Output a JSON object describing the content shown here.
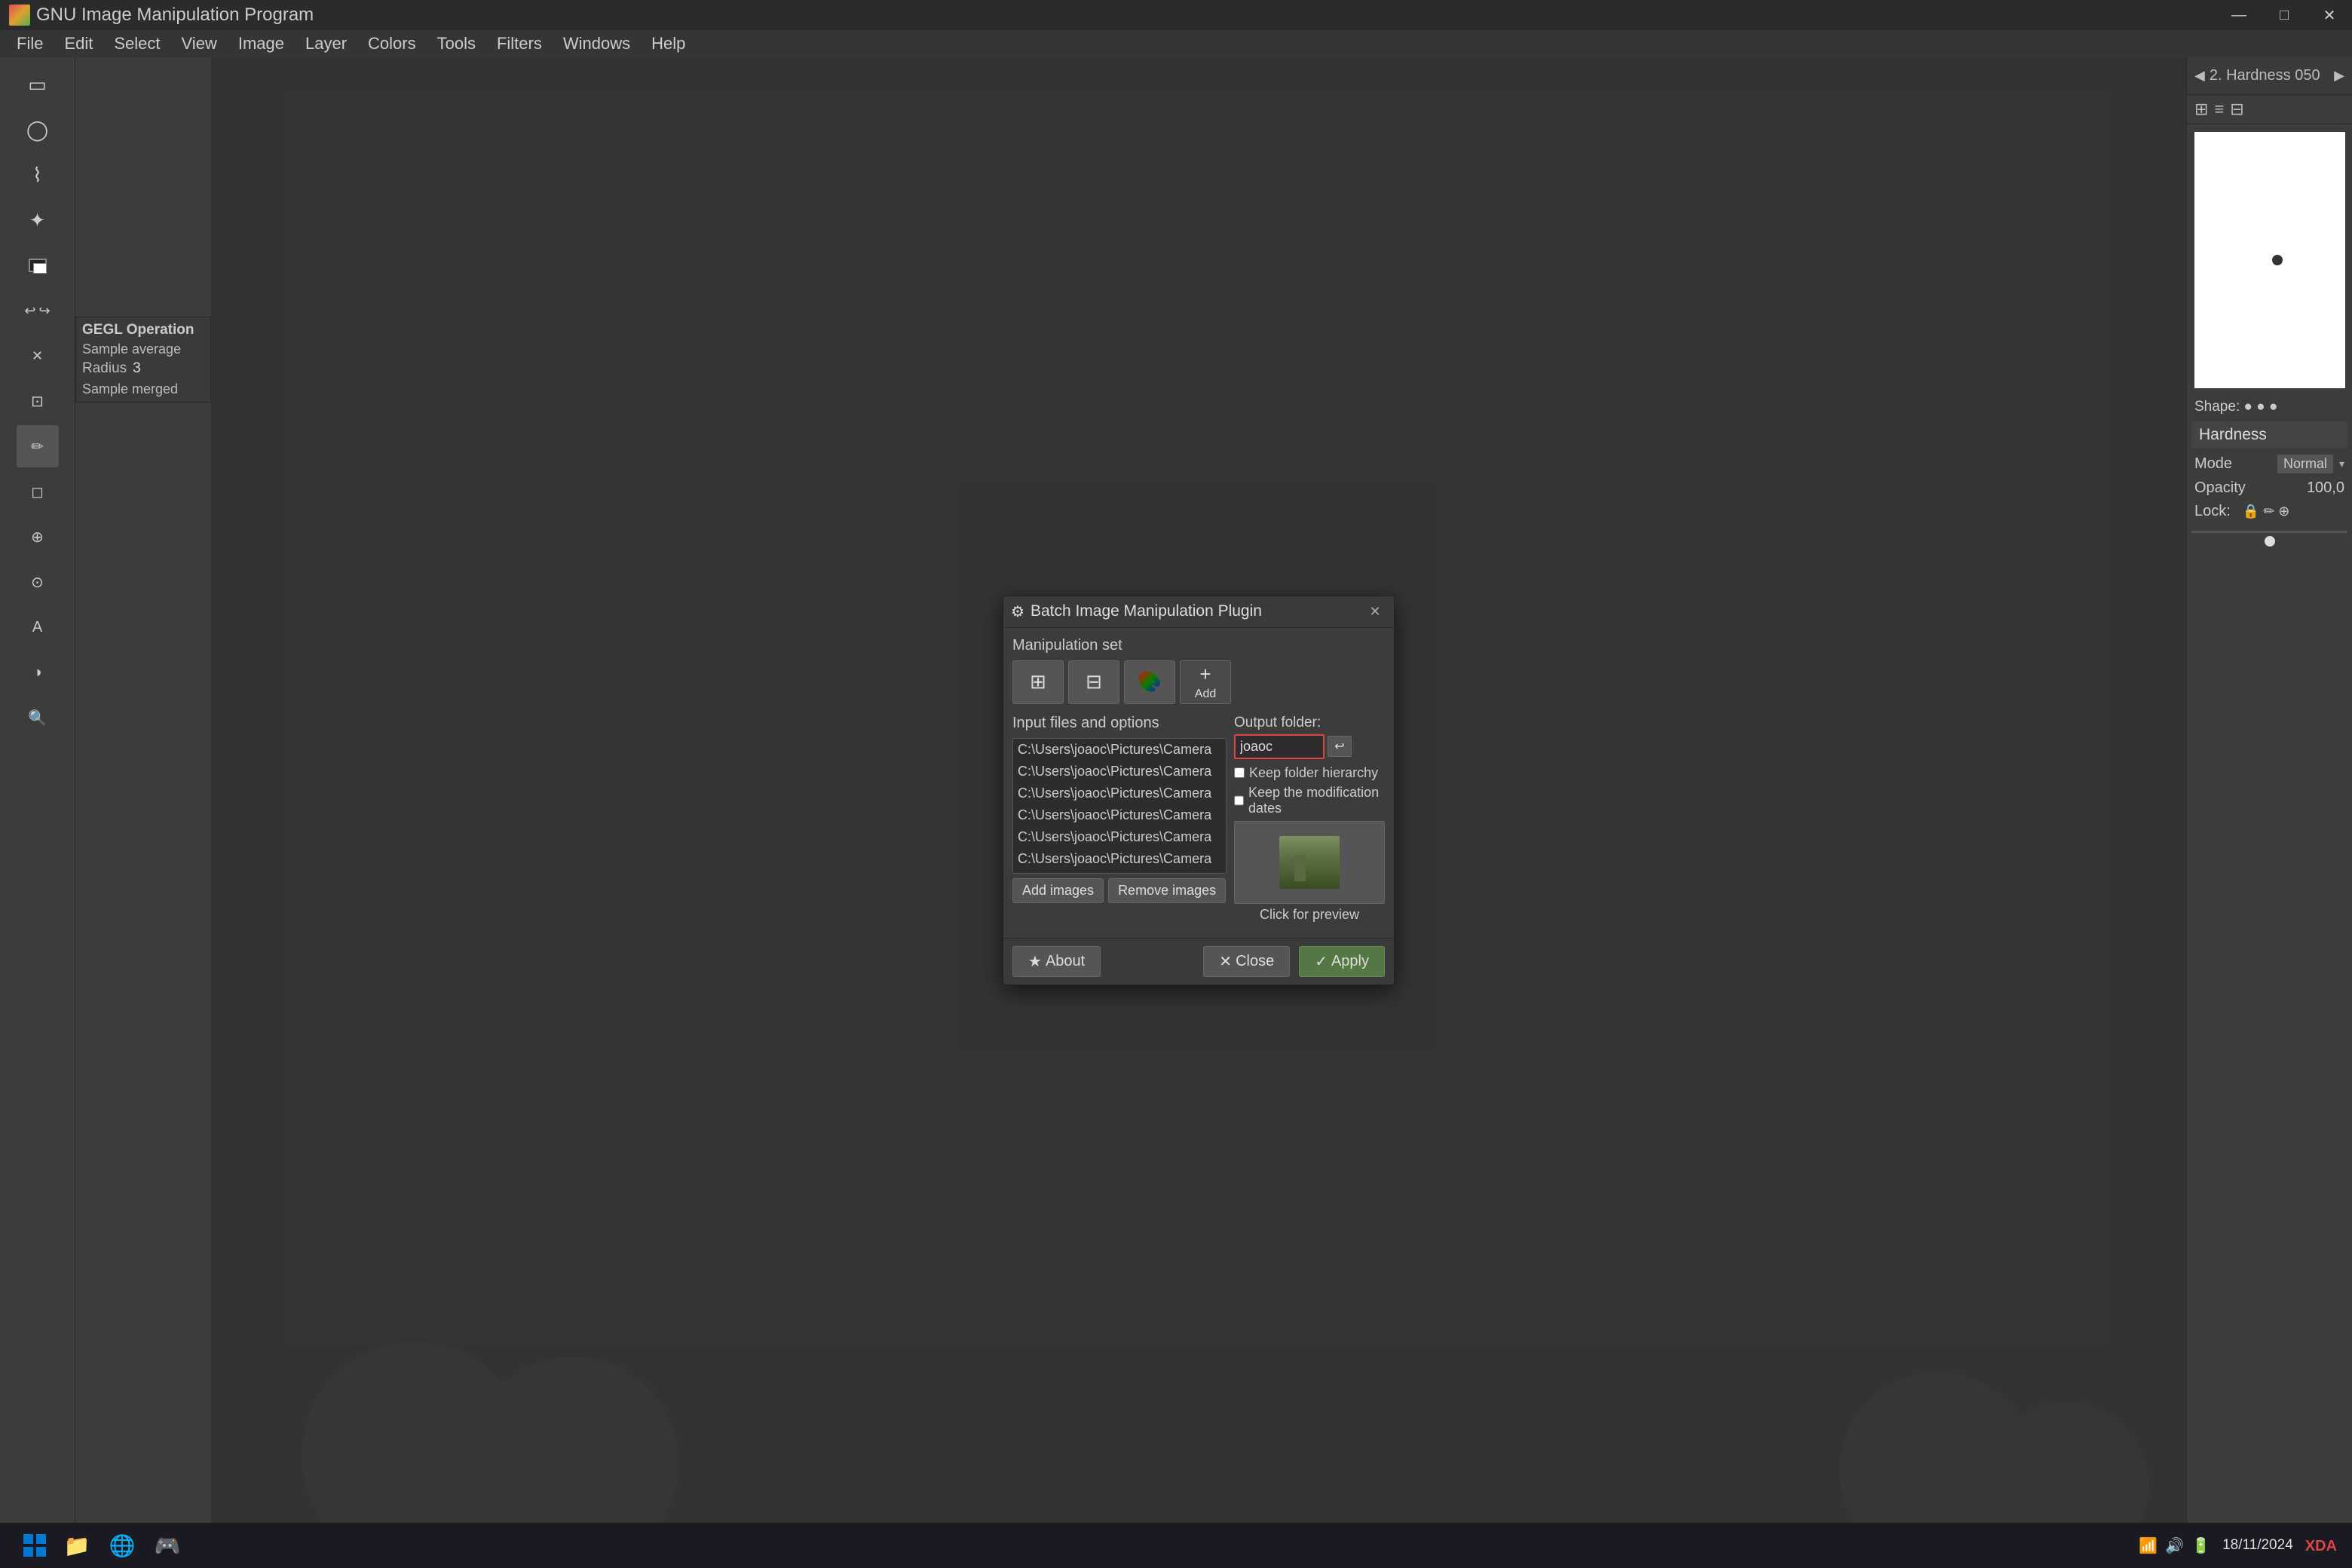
{
  "app": {
    "title": "GNU Image Manipulation Program",
    "window_controls": {
      "minimize": "—",
      "maximize": "□",
      "close": "✕"
    }
  },
  "menubar": {
    "items": [
      "File",
      "Edit",
      "Select",
      "View",
      "Image",
      "Layer",
      "Colors",
      "Tools",
      "Filters",
      "Windows",
      "Help"
    ]
  },
  "toolbar": {
    "tools": [
      {
        "name": "rect-select",
        "icon": "▭"
      },
      {
        "name": "ellipse-select",
        "icon": "◯"
      },
      {
        "name": "lasso",
        "icon": "⌇"
      },
      {
        "name": "fuzzy-select",
        "icon": "✦"
      },
      {
        "name": "crop",
        "icon": "⊡"
      },
      {
        "name": "transform",
        "icon": "⤡"
      },
      {
        "name": "perspective",
        "icon": "⊿"
      },
      {
        "name": "flip",
        "icon": "⇔"
      },
      {
        "name": "text",
        "icon": "A"
      },
      {
        "name": "paint",
        "icon": "✏"
      },
      {
        "name": "eraser",
        "icon": "◻"
      },
      {
        "name": "airbrush",
        "icon": "⊕"
      },
      {
        "name": "clone",
        "icon": "⊙"
      },
      {
        "name": "heal",
        "icon": "✚"
      },
      {
        "name": "dodge-burn",
        "icon": "◑"
      },
      {
        "name": "smudge",
        "icon": "~"
      },
      {
        "name": "zoom",
        "icon": "🔍"
      }
    ]
  },
  "gegl": {
    "title": "GEGL Operation",
    "option1": "Sample average",
    "radius_label": "Radius",
    "radius_value": "3",
    "sample_merged": "Sample merged"
  },
  "right_panel": {
    "hardness_label": "2. Hardness 050",
    "hardness_section": "Hardness",
    "mode_label": "Mode",
    "mode_value": "Normal",
    "opacity_label": "Opacity",
    "opacity_value": "100,0",
    "lock_label": "Lock:",
    "shape_label": "Shape:"
  },
  "dialog": {
    "title": "Batch Image Manipulation Plugin",
    "icon": "⚙",
    "manipulation_set_label": "Manipulation set",
    "manipulations": [
      {
        "name": "scale",
        "icon": "⊞"
      },
      {
        "name": "color-balance",
        "icon": "⊟"
      },
      {
        "name": "curves",
        "icon": "🎨"
      },
      {
        "name": "add",
        "icon": "+",
        "label": "Add"
      }
    ],
    "input_files_label": "Input files and options",
    "files": [
      "C:\\Users\\joaoc\\Pictures\\Camera",
      "C:\\Users\\joaoc\\Pictures\\Camera",
      "C:\\Users\\joaoc\\Pictures\\Camera",
      "C:\\Users\\joaoc\\Pictures\\Camera",
      "C:\\Users\\joaoc\\Pictures\\Camera",
      "C:\\Users\\joaoc\\Pictures\\Camera"
    ],
    "add_images_btn": "Add images",
    "remove_images_btn": "Remove images",
    "output_folder_label": "Output folder:",
    "output_folder_value": "joaoc",
    "keep_hierarchy_label": "Keep folder hierarchy",
    "keep_dates_label": "Keep the modification dates",
    "preview_label": "Click for preview",
    "about_btn": "About",
    "close_btn": "Close",
    "apply_btn": "Apply"
  },
  "statusbar": {
    "text": ""
  },
  "taskbar": {
    "time": "18/11/2024",
    "icons": [
      "⊞",
      "📁",
      "🌐",
      "🎮"
    ]
  }
}
